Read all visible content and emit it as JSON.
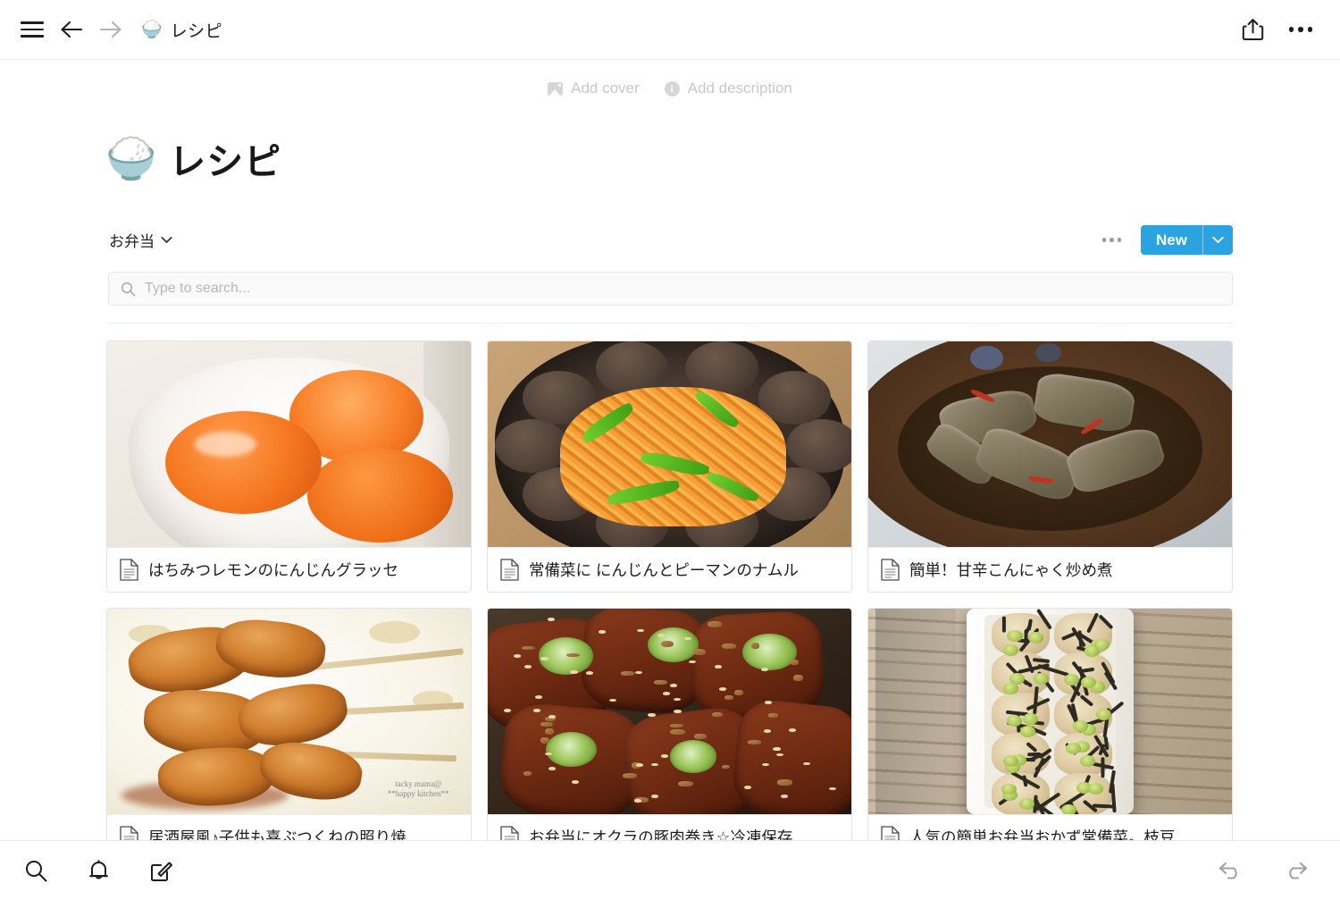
{
  "topbar": {
    "menu_icon": "hamburger-menu-icon",
    "back_icon": "arrow-left-icon",
    "forward_icon": "arrow-right-icon",
    "breadcrumb": {
      "emoji": "🍚",
      "label": "レシピ"
    },
    "share_icon": "share-icon",
    "more_icon": "more-horizontal-icon"
  },
  "meta": {
    "add_cover": "Add cover",
    "add_description": "Add description"
  },
  "page": {
    "emoji": "🍚",
    "title": "レシピ"
  },
  "controls": {
    "view_name": "お弁当",
    "view_caret": "chevron-down-icon",
    "options_icon": "more-horizontal-icon",
    "new_label": "New",
    "new_caret": "chevron-down-icon",
    "accent_color": "#2aa3e0"
  },
  "search": {
    "placeholder": "Type to search...",
    "value": "",
    "icon": "search-icon"
  },
  "gallery": {
    "cards": [
      {
        "title": "はちみつレモンのにんじんグラッセ",
        "icon": "page-icon",
        "art": "p1"
      },
      {
        "title": "常備菜に にんじんとピーマンのナムル",
        "icon": "page-icon",
        "art": "p2"
      },
      {
        "title": "簡単！甘辛こんにゃく炒め煮",
        "icon": "page-icon",
        "art": "p3"
      },
      {
        "title": "居酒屋風♪子供も喜ぶつくねの照り焼...",
        "icon": "page-icon",
        "art": "p4"
      },
      {
        "title": "お弁当にオクラの豚肉巻き☆冷凍保存...",
        "icon": "page-icon",
        "art": "p5"
      },
      {
        "title": "人気の簡単お弁当おかず常備菜。枝豆...",
        "icon": "page-icon",
        "art": "p6"
      }
    ],
    "watermark": "tacky mama@\n**happy kitchen**"
  },
  "bottombar": {
    "search_icon": "search-icon",
    "notifications_icon": "bell-icon",
    "compose_icon": "compose-icon",
    "undo_icon": "undo-icon",
    "redo_icon": "redo-icon"
  }
}
